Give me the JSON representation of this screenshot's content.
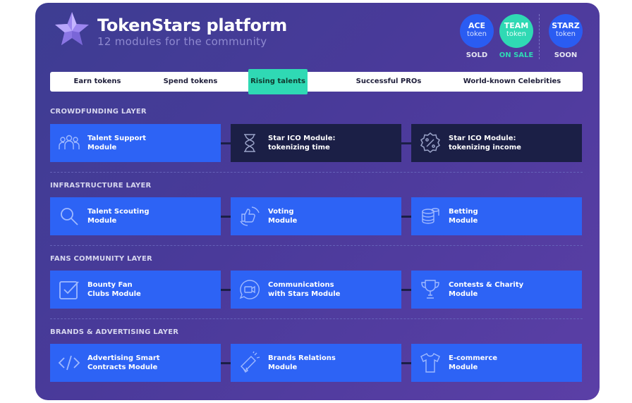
{
  "header": {
    "title": "TokenStars platform",
    "subtitle": "12 modules for the community"
  },
  "tokens": [
    {
      "name": "ACE",
      "sub": "token",
      "status": "SOLD",
      "color": "#2a5cf2"
    },
    {
      "name": "TEAM",
      "sub": "token",
      "status": "ON SALE",
      "color": "#2fd9b4"
    },
    {
      "name": "STARZ",
      "sub": "token",
      "status": "SOON",
      "color": "#2a5cf2"
    }
  ],
  "tabs": [
    {
      "label": "Earn tokens",
      "active": false
    },
    {
      "label": "Spend tokens",
      "active": false
    },
    {
      "label": "Rising talents",
      "active": true
    },
    {
      "label": "Successful PROs",
      "active": false
    },
    {
      "label": "World-known Celebrities",
      "active": false
    }
  ],
  "layers": [
    {
      "title": "CROWDFUNDING LAYER",
      "modules": [
        {
          "line1": "Talent Support",
          "line2": "Module",
          "icon": "people-group-icon",
          "style": "blue"
        },
        {
          "line1": "Star ICO Module:",
          "line2": "tokenizing time",
          "icon": "hourglass-icon",
          "style": "dark"
        },
        {
          "line1": "Star ICO Module:",
          "line2": "tokenizing income",
          "icon": "percent-icon",
          "style": "dark"
        }
      ]
    },
    {
      "title": "INFRASTRUCTURE LAYER",
      "modules": [
        {
          "line1": "Talent Scouting",
          "line2": "Module",
          "icon": "search-icon",
          "style": "blue"
        },
        {
          "line1": "Voting",
          "line2": "Module",
          "icon": "thumbs-vote-icon",
          "style": "blue"
        },
        {
          "line1": "Betting",
          "line2": "Module",
          "icon": "coin-stack-icon",
          "style": "blue"
        }
      ]
    },
    {
      "title": "FANS COMMUNITY LAYER",
      "modules": [
        {
          "line1": "Bounty Fan",
          "line2": "Clubs Module",
          "icon": "checkbox-icon",
          "style": "blue"
        },
        {
          "line1": "Communications",
          "line2": "with Stars Module",
          "icon": "video-chat-icon",
          "style": "blue"
        },
        {
          "line1": "Contests & Charity",
          "line2": "Module",
          "icon": "trophy-icon",
          "style": "blue"
        }
      ]
    },
    {
      "title": "BRANDS & ADVERTISING LAYER",
      "modules": [
        {
          "line1": "Advertising Smart",
          "line2": "Contracts Module",
          "icon": "code-icon",
          "style": "blue"
        },
        {
          "line1": "Brands Relations",
          "line2": "Module",
          "icon": "megaphone-icon",
          "style": "blue"
        },
        {
          "line1": "E-commerce",
          "line2": "Module",
          "icon": "tshirt-icon",
          "style": "blue"
        }
      ]
    }
  ]
}
